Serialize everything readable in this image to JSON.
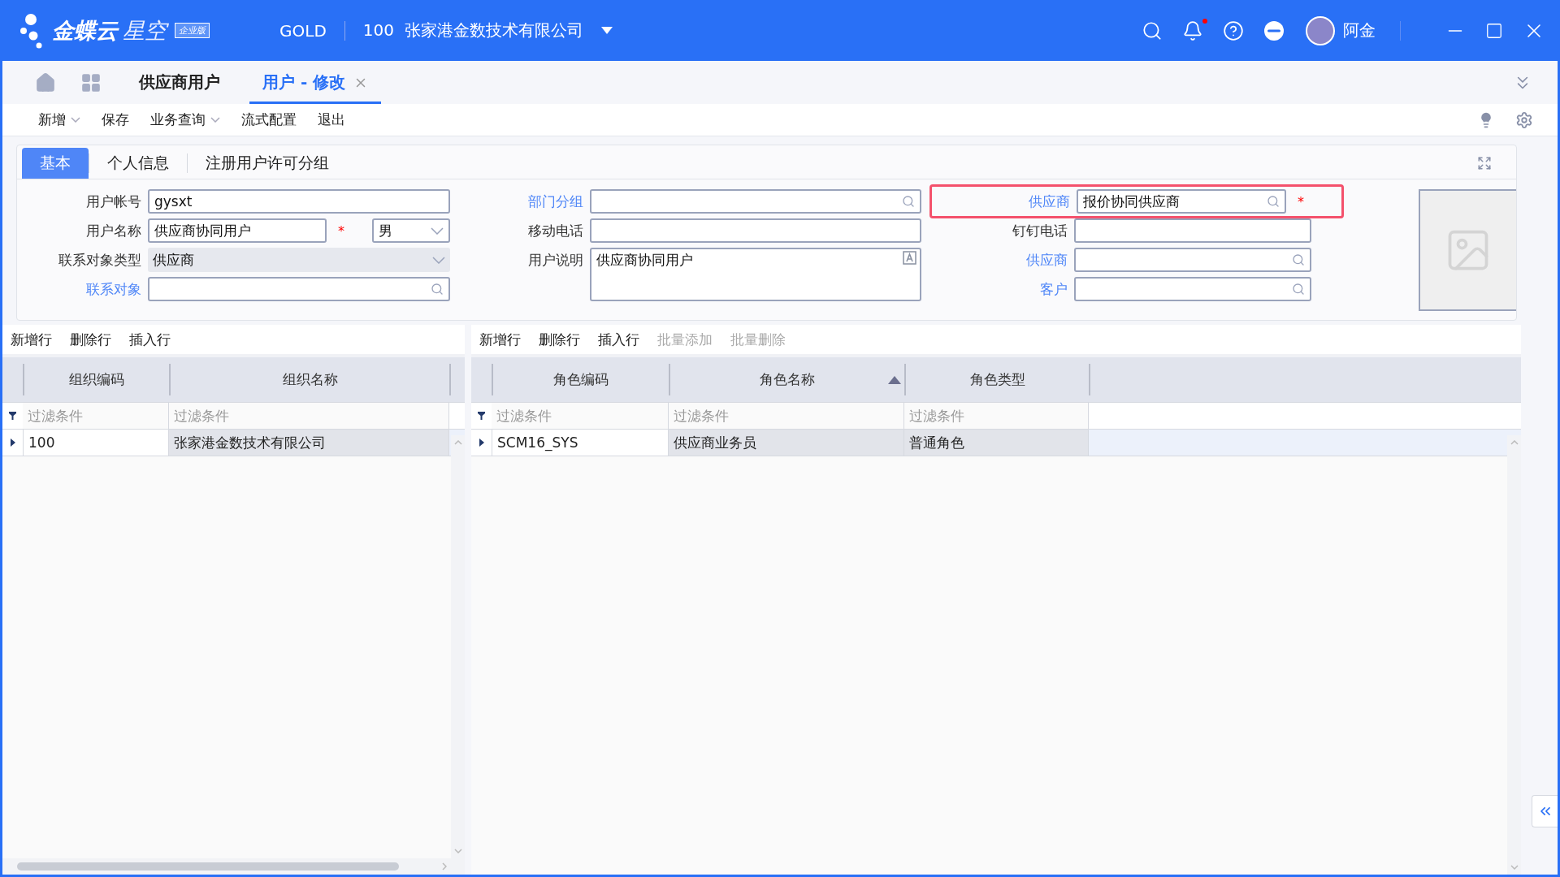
{
  "header": {
    "brand": "金蝶云",
    "brand_sub": "星空",
    "edition_badge": "企业版",
    "data_center": "GOLD",
    "org": "100  张家港金数技术有限公司",
    "user": "阿金",
    "notification_dot": true
  },
  "nav_tabs": [
    {
      "label": "供应商用户",
      "selected": false,
      "closable": false
    },
    {
      "label": "用户 - 修改",
      "selected": true,
      "closable": true
    }
  ],
  "toolbar": [
    {
      "label": "新增",
      "dropdown": true
    },
    {
      "label": "保存",
      "dropdown": false
    },
    {
      "label": "业务查询",
      "dropdown": true
    },
    {
      "label": "流式配置",
      "dropdown": false
    },
    {
      "label": "退出",
      "dropdown": false
    }
  ],
  "form_tabs": [
    {
      "label": "基本",
      "selected": true
    },
    {
      "label": "个人信息",
      "selected": false
    },
    {
      "label": "注册用户许可分组",
      "selected": false
    }
  ],
  "form_columns": [
    {
      "fields": [
        {
          "kind": "text",
          "label": "用户帐号",
          "value": "gysxt",
          "link": false,
          "disabled": false,
          "highlighted": false
        },
        {
          "kind": "text",
          "label": "用户名称",
          "value": "供应商协同用户",
          "link": false,
          "required_mark": "*",
          "disabled": false,
          "highlighted": false,
          "extra": {
            "kind": "select",
            "value": "男"
          }
        },
        {
          "kind": "select",
          "label": "联系对象类型",
          "value": "供应商",
          "link": false,
          "disabled": true,
          "highlighted": false
        },
        {
          "kind": "lookup",
          "label": "联系对象",
          "link": true,
          "disabled": false,
          "highlighted": false
        }
      ]
    },
    {
      "fields": [
        {
          "kind": "lookup",
          "label": "部门分组",
          "link": true,
          "disabled": false,
          "highlighted": false
        },
        {
          "kind": "text",
          "label": "移动电话",
          "link": false,
          "disabled": false,
          "highlighted": false
        },
        {
          "kind": "textarea",
          "label": "用户说明",
          "value": "供应商协同用户",
          "link": false,
          "disabled": false,
          "highlighted": false
        }
      ]
    },
    {
      "fields": [
        {
          "kind": "lookup",
          "label": "供应商",
          "value": "报价协同供应商",
          "link": true,
          "required_mark": "*",
          "disabled": false,
          "highlighted": true
        },
        {
          "kind": "text",
          "label": "钉钉电话",
          "link": false,
          "disabled": false,
          "highlighted": false
        },
        {
          "kind": "lookup",
          "label": "供应商",
          "link": true,
          "disabled": false,
          "highlighted": false
        },
        {
          "kind": "lookup",
          "label": "客户",
          "link": true,
          "disabled": false,
          "highlighted": false
        }
      ]
    }
  ],
  "grids": [
    {
      "actions": [
        {
          "label": "新增行",
          "disabled": false
        },
        {
          "label": "删除行",
          "disabled": false
        },
        {
          "label": "插入行",
          "disabled": false
        }
      ],
      "columns": [
        {
          "label": "组织编码",
          "filter_placeholder": "过滤条件",
          "sorted_ascending": false
        },
        {
          "label": "组织名称",
          "filter_placeholder": "过滤条件",
          "sorted_ascending": false
        }
      ],
      "rows": [
        {
          "cells": [
            "100",
            "张家港金数技术有限公司"
          ],
          "selected": true
        }
      ]
    },
    {
      "actions": [
        {
          "label": "新增行",
          "disabled": false
        },
        {
          "label": "删除行",
          "disabled": false
        },
        {
          "label": "插入行",
          "disabled": false
        },
        {
          "label": "批量添加",
          "disabled": true
        },
        {
          "label": "批量删除",
          "disabled": true
        }
      ],
      "columns": [
        {
          "label": "角色编码",
          "filter_placeholder": "过滤条件",
          "sorted_ascending": false
        },
        {
          "label": "角色名称",
          "filter_placeholder": "过滤条件",
          "sorted_ascending": true
        },
        {
          "label": "角色类型",
          "filter_placeholder": "过滤条件",
          "sorted_ascending": false
        }
      ],
      "rows": [
        {
          "cells": [
            "SCM16_SYS",
            "供应商业务员",
            "普通角色"
          ],
          "selected": true
        }
      ]
    }
  ]
}
